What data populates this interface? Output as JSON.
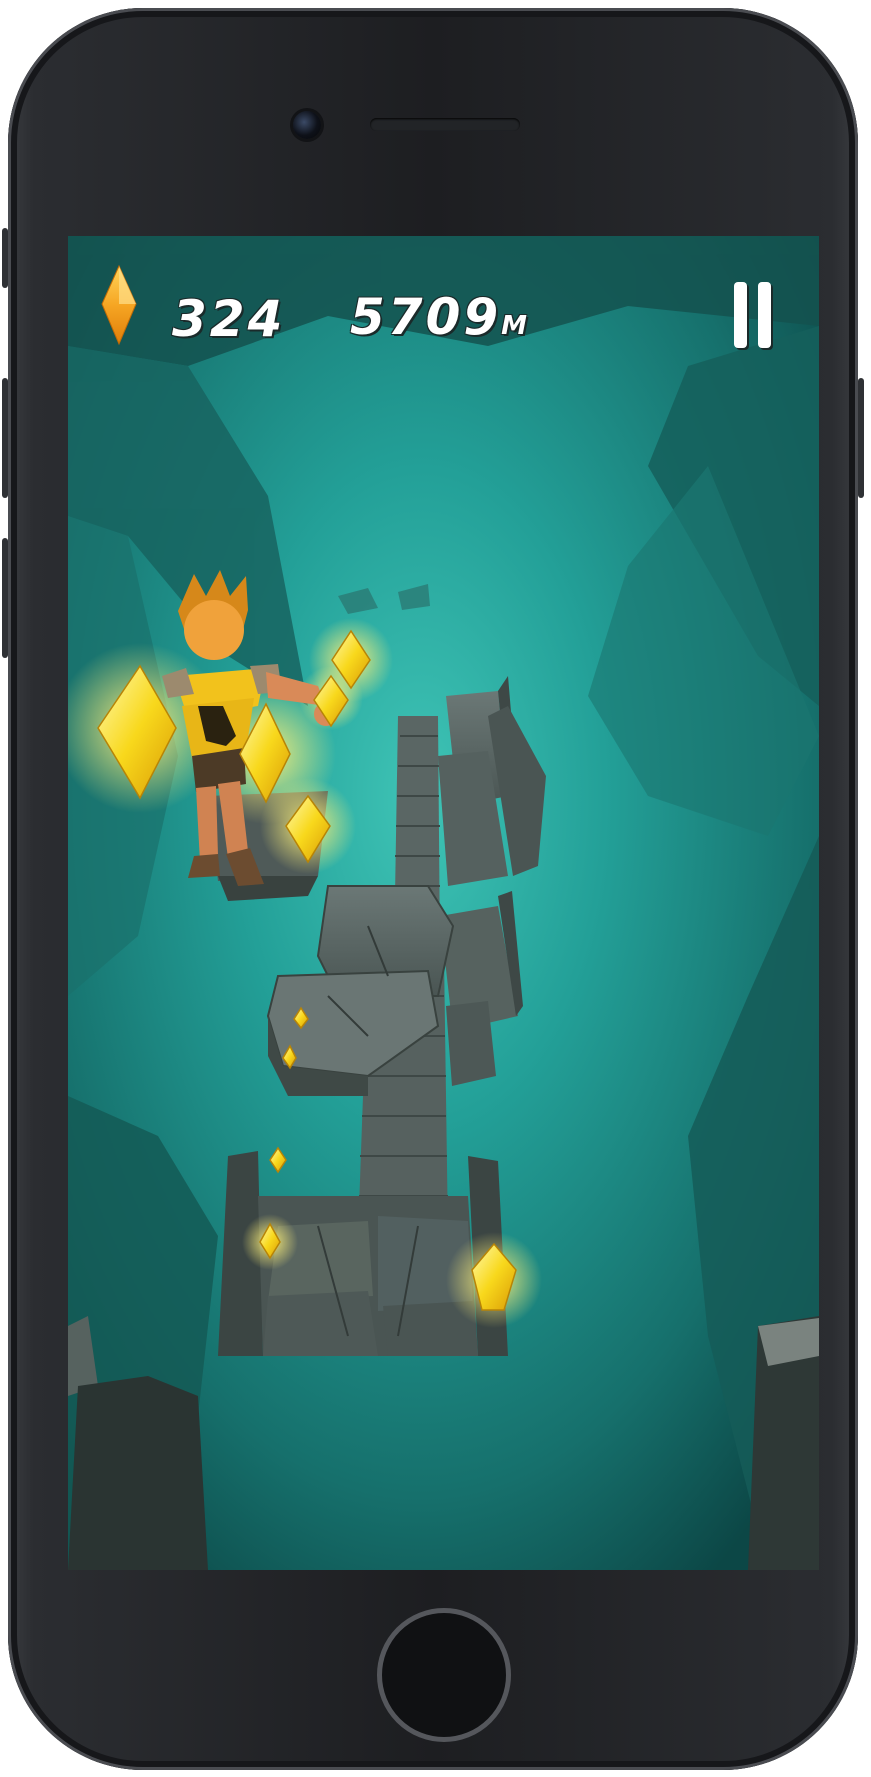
{
  "hud": {
    "gem_icon": "yellow-diamond-gem-icon",
    "gem_count": "324",
    "distance_value": "5709",
    "distance_unit": "M",
    "pause_icon": "pause-icon"
  },
  "colors": {
    "gem": "#f5c518",
    "gem_glow": "#fff27a",
    "cave_teal": "#1e8a86",
    "stone": "#4e5a58"
  }
}
